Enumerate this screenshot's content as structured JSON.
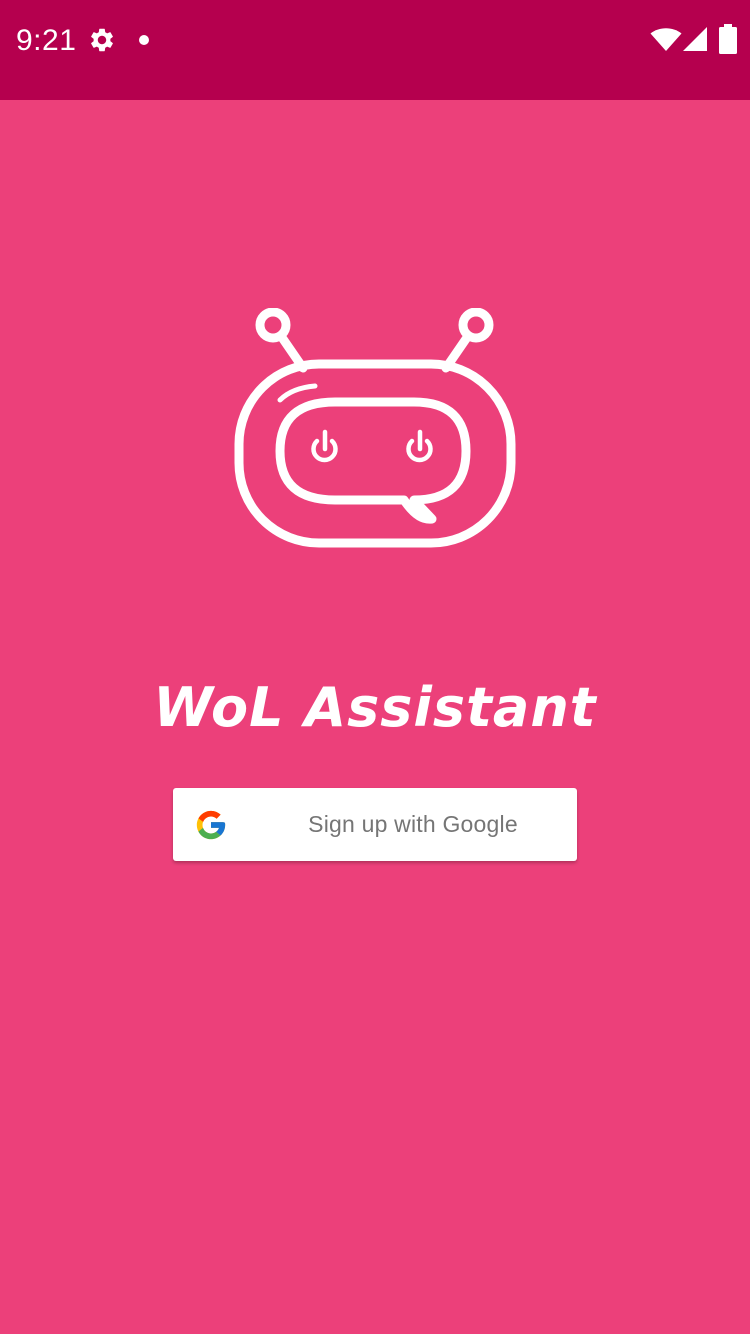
{
  "status_bar": {
    "time": "9:21",
    "icons": [
      "settings-gear-icon",
      "notification-dot-icon",
      "wifi-icon",
      "cell-signal-icon",
      "battery-icon"
    ],
    "background_color": "#B5004E"
  },
  "app": {
    "title": "WoL Assistant",
    "logo_icon": "robot-chat-icon",
    "background_color": "#EC407A"
  },
  "signin": {
    "label": "Sign up with Google",
    "icon": "google-g-icon"
  }
}
